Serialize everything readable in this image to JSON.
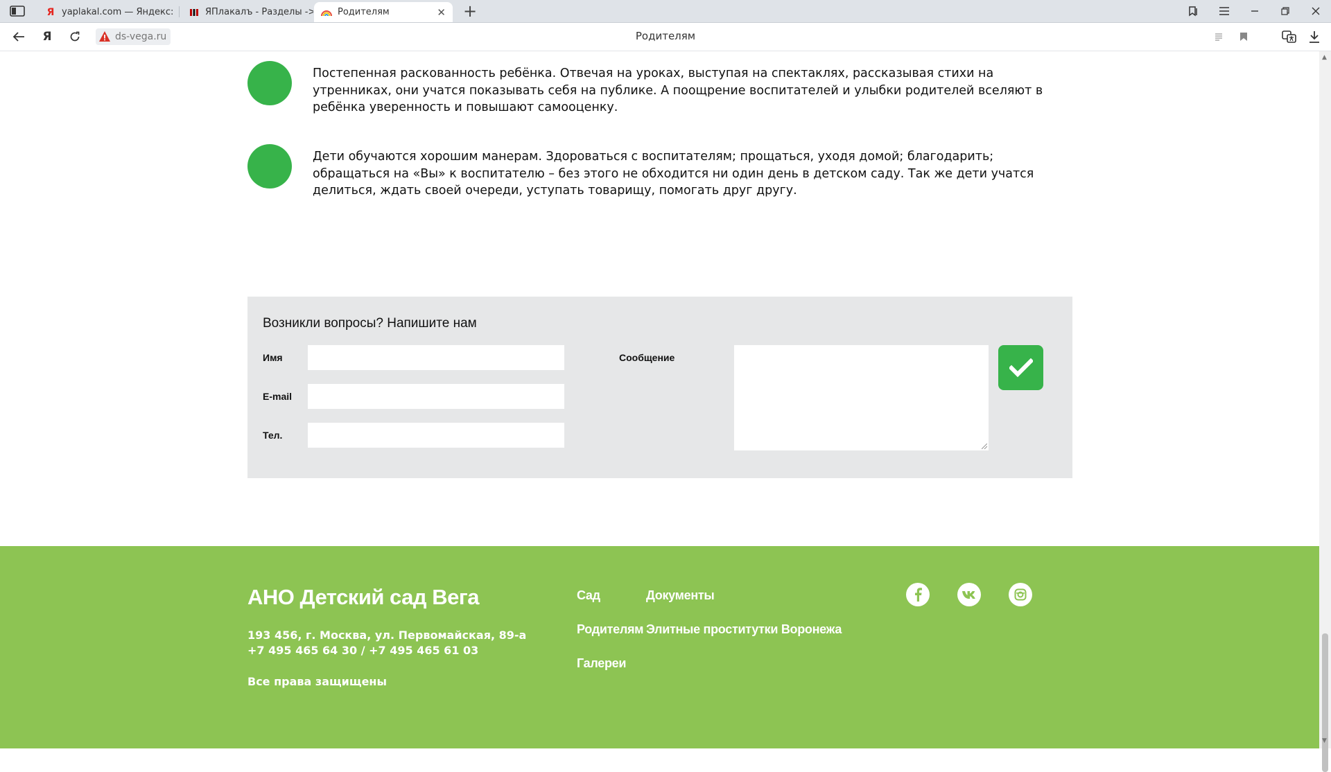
{
  "browser": {
    "tabs": [
      {
        "title": "yaplakal.com — Яндекс: на",
        "favicon": "yandex-icon"
      },
      {
        "title": "ЯПлакалъ - Разделы -> Ци",
        "favicon": "yaplakal-icon"
      },
      {
        "title": "Родителям",
        "favicon": "rainbow-icon",
        "active": true
      }
    ],
    "url": "ds-vega.ru",
    "page_title": "Родителям"
  },
  "content": {
    "benefits": [
      "Постепенная раскованность ребёнка. Отвечая на уроках, выступая на спектаклях, рассказывая стихи на утренниках, они учатся показывать себя на публике. А поощрение воспитателей и улыбки родителей вселяют в ребёнка уверенность и повышают самооценку.",
      "Дети обучаются хорошим манерам. Здороваться с воспитателям; прощаться, уходя домой; благодарить; обращаться на «Вы» к воспитателю – без этого не обходится ни один день в детском саду. Так же дети учатся делиться, ждать своей очереди, уступать товарищу, помогать друг другу."
    ]
  },
  "contact_form": {
    "title": "Возникли вопросы? Напишите нам",
    "name_label": "Имя",
    "email_label": "E-mail",
    "phone_label": "Тел.",
    "message_label": "Сообщение",
    "name_value": "",
    "email_value": "",
    "phone_value": "",
    "message_value": ""
  },
  "footer": {
    "org_name": "АНО Детский сад Вега",
    "address": "193 456, г. Москва, ул. Первомайская, 89-а",
    "phones": "+7 495 465 64 30 / +7 495 465 61 03",
    "rights": "Все права защищены",
    "links": [
      "Сад",
      "Документы",
      "Родителям",
      "Элитные проститутки Воронежа",
      "Галереи"
    ],
    "social": [
      "facebook-icon",
      "vk-icon",
      "instagram-icon"
    ]
  },
  "colors": {
    "accent_green": "#37b34a",
    "footer_green": "#8dc453",
    "form_bg": "#e6e7e8"
  }
}
